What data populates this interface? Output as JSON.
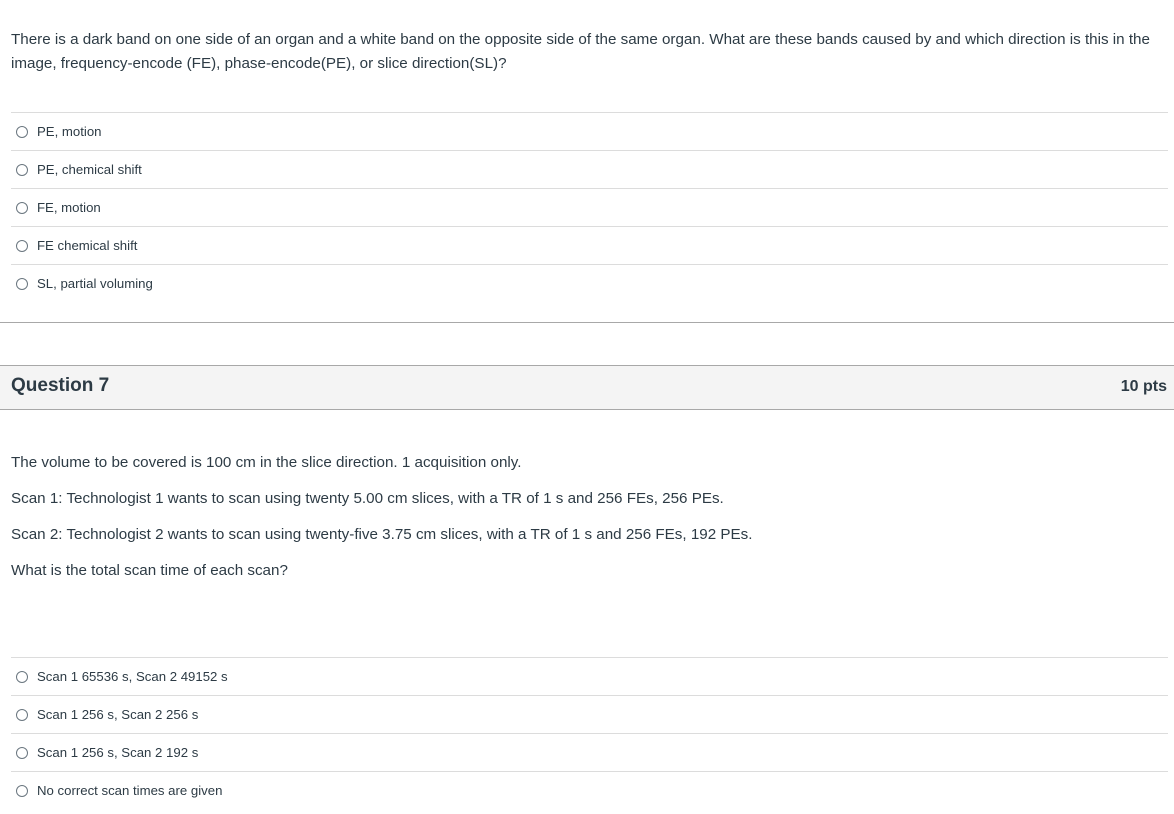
{
  "question6": {
    "text": "There is a dark band on one side of an organ and a white band on the opposite side of the same organ. What are these bands caused by and which direction is this in the image, frequency-encode (FE), phase-encode(PE), or slice direction(SL)?",
    "answers": [
      {
        "label": "PE, motion",
        "selected": false
      },
      {
        "label": "PE, chemical shift",
        "selected": false
      },
      {
        "label": "FE, motion",
        "selected": false
      },
      {
        "label": "FE chemical shift",
        "selected": false
      },
      {
        "label": "SL, partial voluming",
        "selected": false
      }
    ]
  },
  "question7": {
    "title": "Question 7",
    "points": "10 pts",
    "paragraphs": [
      "The volume to be covered is 100 cm in the slice direction. 1 acquisition only.",
      "Scan 1: Technologist 1 wants to scan using twenty 5.00 cm slices, with a TR of 1 s and 256 FEs, 256 PEs.",
      "Scan 2: Technologist 2 wants to scan using twenty-five 3.75 cm slices, with a TR of 1 s and 256 FEs, 192 PEs.",
      "What is the total scan time of each scan?"
    ],
    "answers": [
      {
        "label": "Scan 1 65536 s, Scan 2 49152 s",
        "selected": false
      },
      {
        "label": "Scan 1 256 s, Scan 2 256 s",
        "selected": false
      },
      {
        "label": "Scan 1 256 s, Scan 2 192 s",
        "selected": false
      },
      {
        "label": "No correct scan times are given",
        "selected": false
      }
    ]
  },
  "icons": {
    "radio": "radio-unchecked-icon"
  }
}
